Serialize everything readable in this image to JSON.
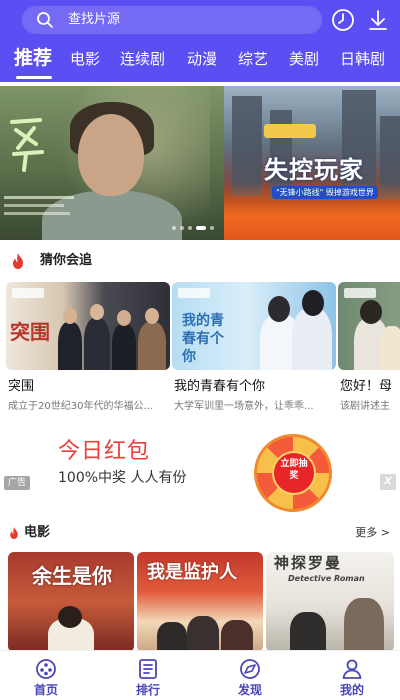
{
  "search": {
    "placeholder": "查找片源"
  },
  "tabs": [
    {
      "label": "推荐",
      "active": true
    },
    {
      "label": "电影"
    },
    {
      "label": "连续剧"
    },
    {
      "label": "动漫"
    },
    {
      "label": "综艺"
    },
    {
      "label": "美剧"
    },
    {
      "label": "日韩剧"
    }
  ],
  "banner": {
    "slide_b_title": "失控玩家",
    "slide_b_tagline": "\"无锋小路线\" 毁掉游戏世界",
    "page_indicator": {
      "count": 5,
      "active_index": 3
    }
  },
  "recommend": {
    "title": "猜你会追",
    "items": [
      {
        "title": "突围",
        "desc": "成立于20世纪30年代的华福公...",
        "poster_text": "突围"
      },
      {
        "title": "我的青春有个你",
        "desc": "大学军训里一场意外，让乖乖...",
        "poster_text": "我的青春有个你"
      },
      {
        "title": "您好！母",
        "desc": "该剧讲述主"
      }
    ]
  },
  "ad": {
    "title": "今日红包",
    "subtitle": "100%中奖 人人有份",
    "badge": "广告",
    "wheel_text": "立即抽奖",
    "close": "X"
  },
  "movies_section": {
    "title": "电影",
    "more": "更多 >",
    "items": [
      {
        "poster_text": "余生是你"
      },
      {
        "poster_text": "我是监护人"
      },
      {
        "poster_text": "神探罗曼",
        "poster_subtext": "Detective Roman"
      }
    ]
  },
  "bottom_nav": [
    {
      "label": "首页",
      "icon": "home-icon",
      "active": true
    },
    {
      "label": "排行",
      "icon": "ranking-icon"
    },
    {
      "label": "发现",
      "icon": "discover-icon"
    },
    {
      "label": "我的",
      "icon": "profile-icon"
    }
  ],
  "colors": {
    "header_bg": "#5b4ef2",
    "nav_active": "#4a45b8",
    "ad_red": "#ea3f38",
    "fire": "#e8392f"
  }
}
